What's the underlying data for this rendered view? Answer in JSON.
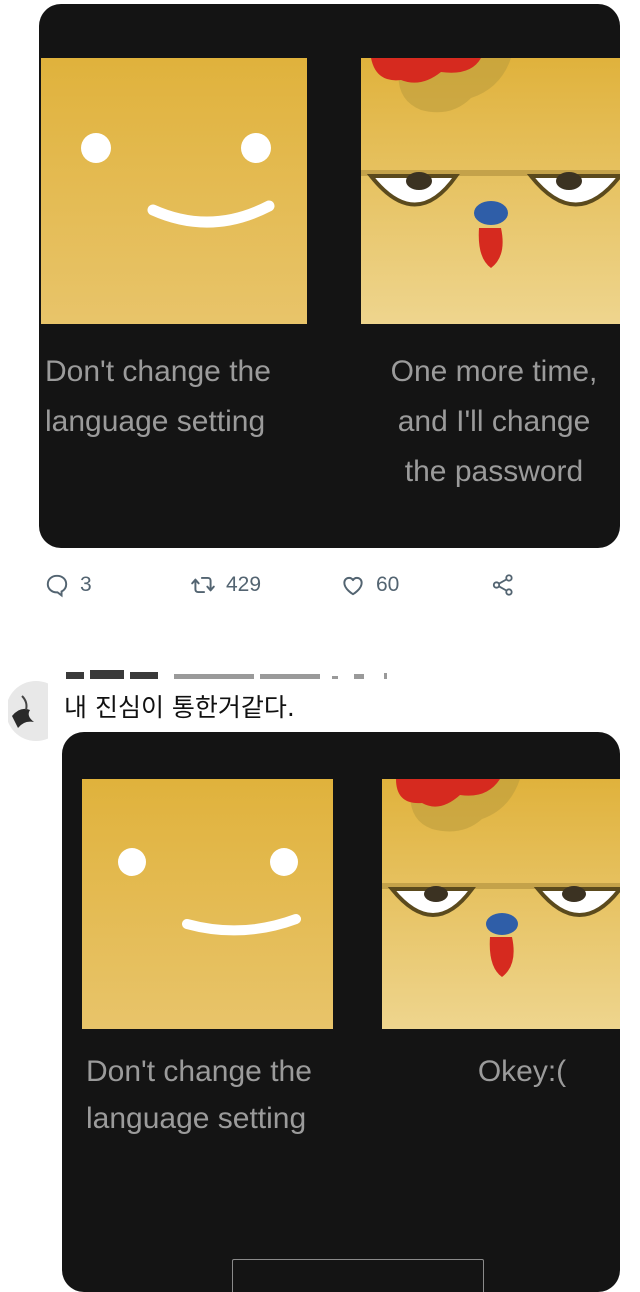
{
  "post": {
    "tiles": {
      "left_caption_line1": "Don't change the",
      "left_caption_line2": "language setting",
      "right_caption_line1": "One more time,",
      "right_caption_line2": "and I'll change",
      "right_caption_line3": "the password"
    },
    "actions": {
      "replies_count": "3",
      "retweets_count": "429",
      "likes_count": "60"
    }
  },
  "reply": {
    "comment_text": "내 진심이 통한거같다.",
    "tiles": {
      "left_caption_line1": "Don't change the",
      "left_caption_line2": "language setting",
      "right_caption": "Okey:("
    }
  },
  "icons": {
    "reply": "reply-bubble-icon",
    "retweet": "retweet-icon",
    "like": "heart-icon",
    "share": "share-icon"
  },
  "colors": {
    "card_bg": "#141414",
    "tile_gold": "#e2b440",
    "caption_gray": "#9b9b9b",
    "action_gray": "#536471"
  }
}
